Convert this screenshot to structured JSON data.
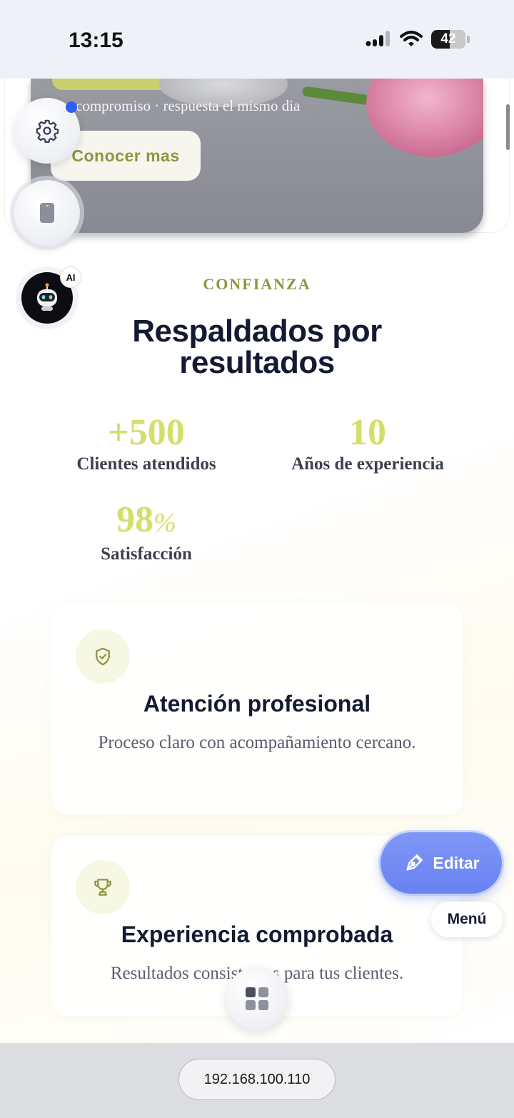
{
  "status_bar": {
    "time": "13:15",
    "battery": "42"
  },
  "hero": {
    "note": "compromiso · respuesta el mismo dia",
    "cta_label": "Conocer mas"
  },
  "floating": {
    "ai_badge": "AI",
    "editar_label": "Editar",
    "menu_label": "Menú"
  },
  "section": {
    "eyebrow": "CONFIANZA",
    "headline_line1": "Respaldados por",
    "headline_line2": "resultados"
  },
  "stats": [
    {
      "value": "+500",
      "label": "Clientes atendidos"
    },
    {
      "value": "10",
      "label": "Años de experiencia"
    },
    {
      "value": "98",
      "suffix": "%",
      "label": "Satisfacción"
    }
  ],
  "cards": [
    {
      "icon": "shield-check-icon",
      "title": "Atención profesional",
      "text": "Proceso claro con acompañamiento cercano."
    },
    {
      "icon": "trophy-icon",
      "title": "Experiencia comprobada",
      "text": "Resultados consistentes para tus clientes."
    }
  ],
  "address_bar": {
    "url": "192.168.100.110"
  },
  "colors": {
    "accent_olive": "#8f9440",
    "stat_lime": "#d4df6b",
    "editar_blue": "#6a82f2",
    "heading_navy": "#151a33"
  }
}
